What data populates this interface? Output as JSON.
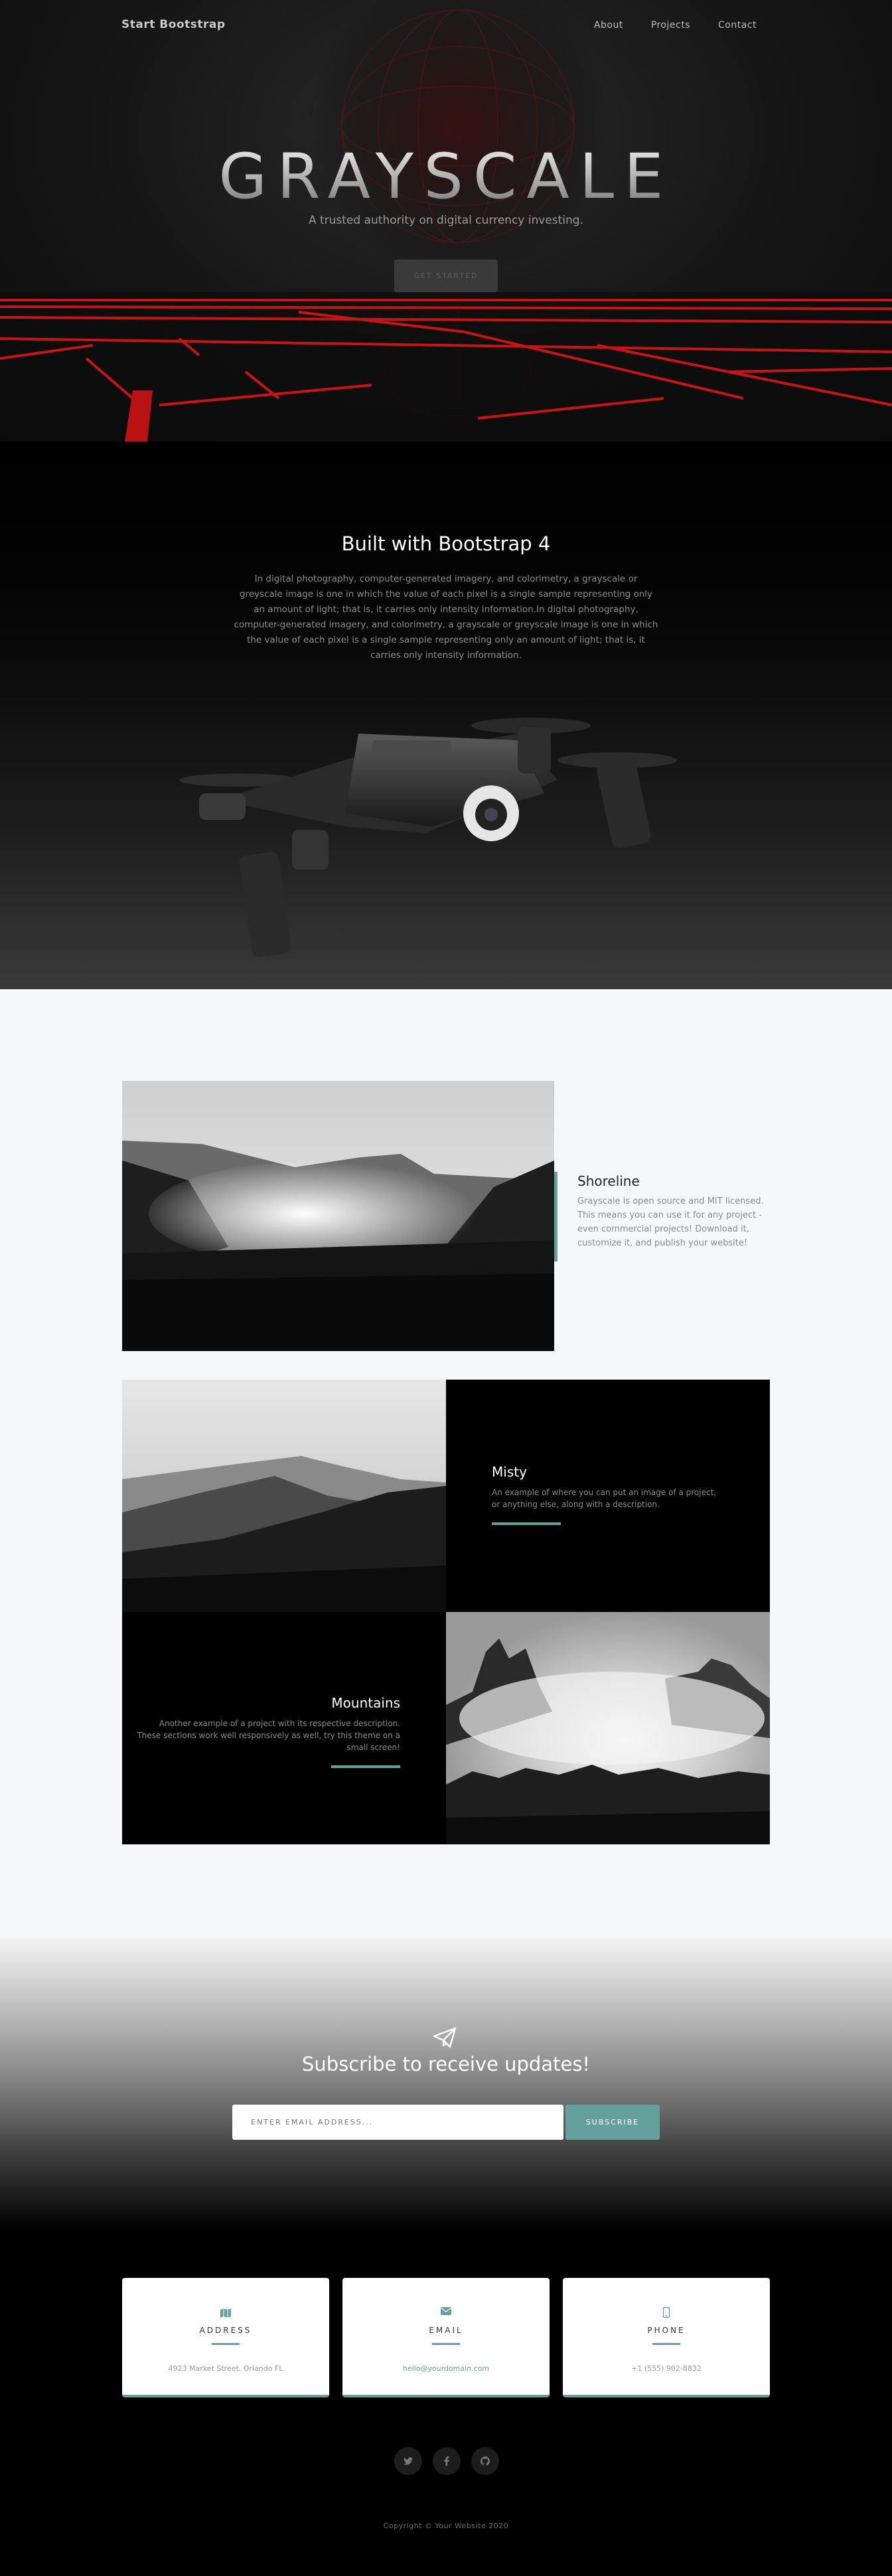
{
  "nav": {
    "brand": "Start Bootstrap",
    "links": [
      "About",
      "Projects",
      "Contact"
    ]
  },
  "hero": {
    "title": "GRAYSCALE",
    "subtitle": "A trusted authority on digital currency investing.",
    "button": "GET STARTED"
  },
  "about": {
    "title": "Built with Bootstrap 4",
    "text": "In digital photography, computer-generated imagery, and colorimetry, a grayscale or greyscale image is one in which the value of each pixel is a single sample representing only an amount of light; that is, it carries only intensity information.In digital photography, computer-generated imagery, and colorimetry, a grayscale or greyscale image is one in which the value of each pixel is a single sample representing only an amount of light; that is, it carries only intensity information."
  },
  "projects": {
    "featured": {
      "title": "Shoreline",
      "desc": "Grayscale is open source and MIT licensed. This means you can use it for any project - even commercial projects! Download it, customize it, and publish your website!"
    },
    "misty": {
      "title": "Misty",
      "desc": "An example of where you can put an image of a project, or anything else, along with a description."
    },
    "mountains": {
      "title": "Mountains",
      "desc": "Another example of a project with its respective description. These sections work well responsively as well, try this theme on a small screen!"
    }
  },
  "signup": {
    "title": "Subscribe to receive updates!",
    "placeholder": "ENTER EMAIL ADDRESS...",
    "button": "SUBSCRIBE"
  },
  "contact": {
    "address": {
      "label": "ADDRESS",
      "value": "4923 Market Street, Orlando FL",
      "icon": "map-icon"
    },
    "email": {
      "label": "EMAIL",
      "value": "hello@yourdomain.com",
      "icon": "envelope-icon"
    },
    "phone": {
      "label": "PHONE",
      "value": "+1 (555) 902-8832",
      "icon": "mobile-icon"
    }
  },
  "socials": [
    "twitter-icon",
    "facebook-icon",
    "github-icon"
  ],
  "footer": {
    "copyright": "Copyright © Your Website 2020"
  },
  "colors": {
    "accent": "#64a19d",
    "grid_red": "#c81414"
  }
}
